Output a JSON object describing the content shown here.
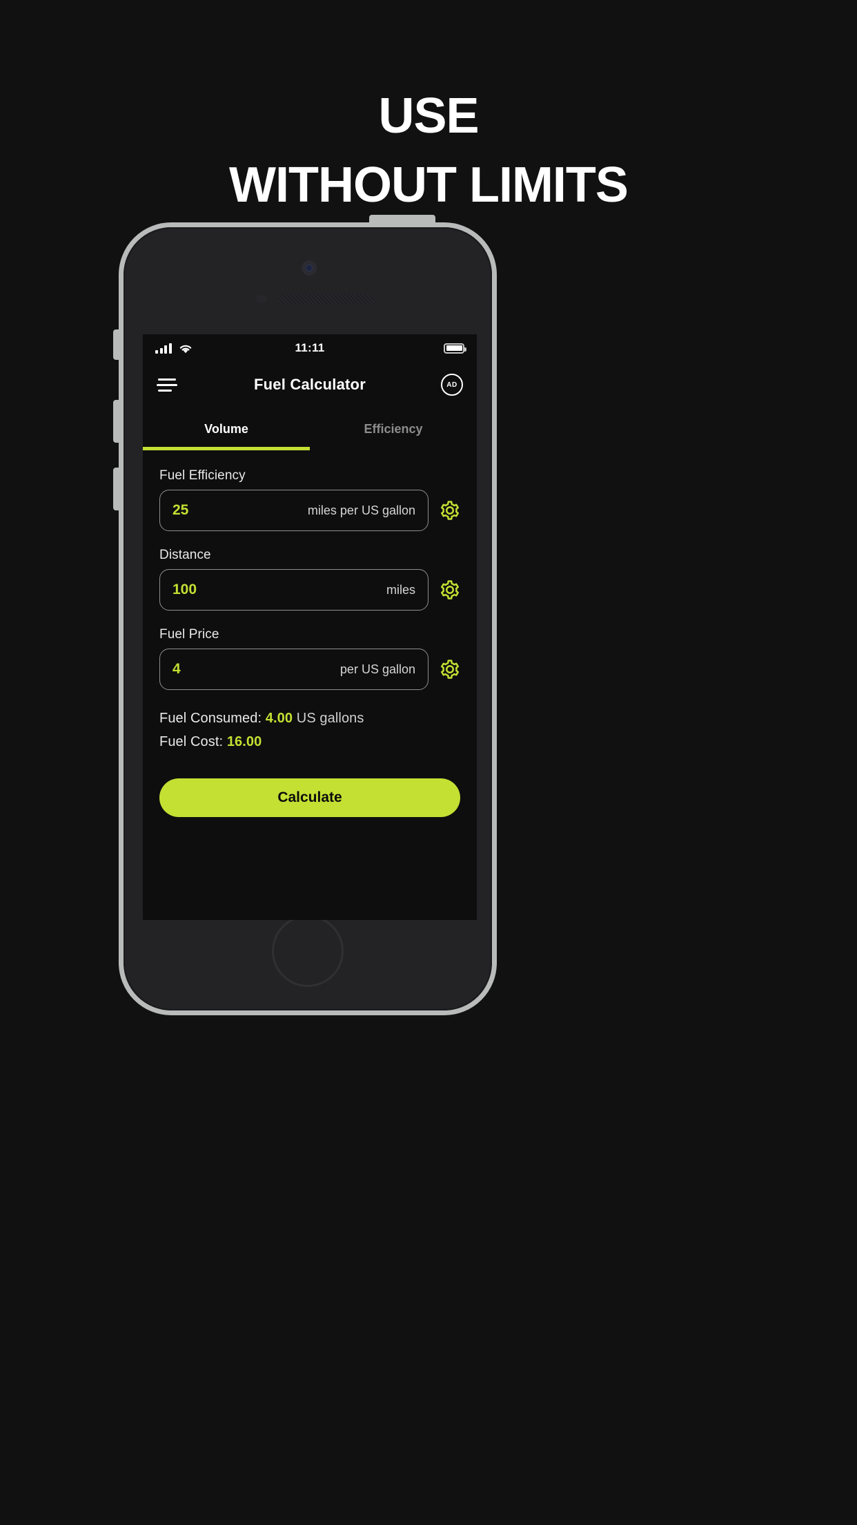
{
  "promo": {
    "headline_line1": "USE",
    "headline_line2": "WITHOUT LIMITS",
    "background_color": "#111111",
    "text_color": "#ffffff"
  },
  "theme": {
    "accent_color": "#c3e033",
    "screen_background": "#0e0e0e",
    "bezel_color": "#b9bbbb",
    "phone_body_color": "#232326"
  },
  "statusbar": {
    "signal_icon": "cellular-signal-icon",
    "wifi_icon": "wifi-icon",
    "time": "11:11",
    "battery_icon": "battery-full-icon"
  },
  "appbar": {
    "menu_icon": "hamburger-menu-icon",
    "title": "Fuel Calculator",
    "ad_label": "AD"
  },
  "tabs": [
    {
      "label": "Volume",
      "active": true
    },
    {
      "label": "Efficiency",
      "active": false
    }
  ],
  "fields": [
    {
      "label": "Fuel Efficiency",
      "value": "25",
      "unit": "miles per US gallon",
      "settings_icon": "gear-icon"
    },
    {
      "label": "Distance",
      "value": "100",
      "unit": "miles",
      "settings_icon": "gear-icon"
    },
    {
      "label": "Fuel Price",
      "value": "4",
      "unit": "per US gallon",
      "settings_icon": "gear-icon"
    }
  ],
  "results": [
    {
      "prefix": "Fuel Consumed: ",
      "value": "4.00",
      "suffix": " US gallons"
    },
    {
      "prefix": "Fuel Cost: ",
      "value": "16.00",
      "suffix": ""
    }
  ],
  "actions": {
    "calculate_label": "Calculate"
  }
}
